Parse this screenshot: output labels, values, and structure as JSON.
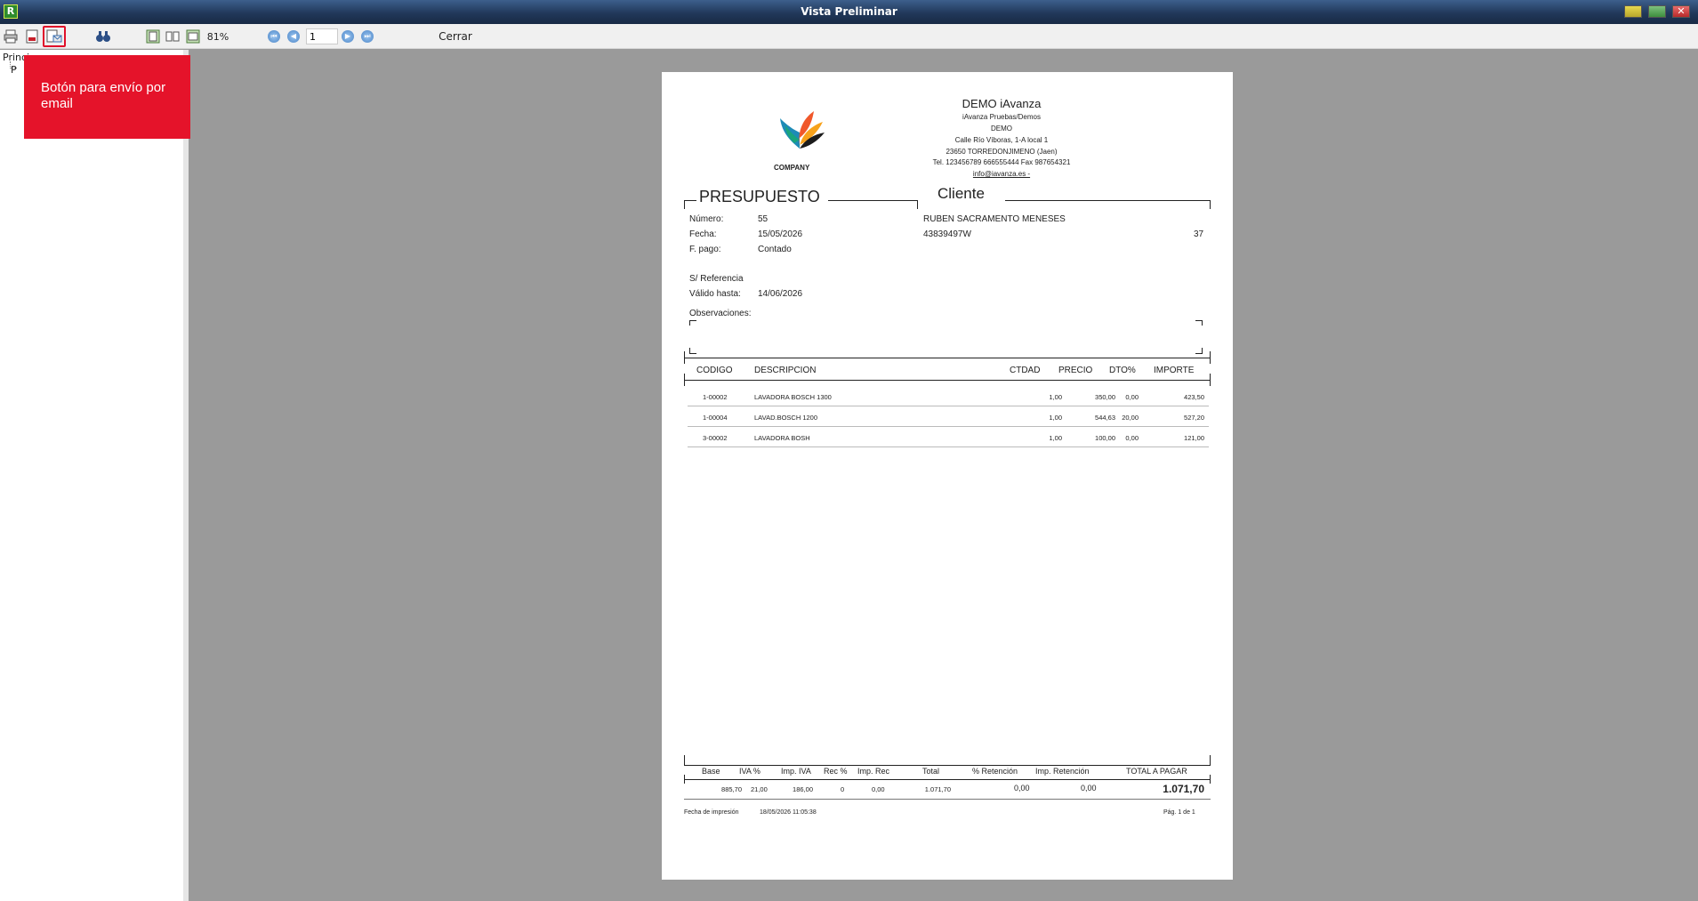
{
  "window": {
    "title": "Vista Preliminar",
    "app_icon": "R"
  },
  "toolbar": {
    "zoom": "81%",
    "page": "1",
    "close_label": "Cerrar"
  },
  "left_panel": {
    "tree_root": "Princi",
    "tree_child": "P"
  },
  "callout": {
    "text": "Botón para envío por email"
  },
  "document": {
    "company": {
      "logo_text": "COMPANY",
      "name": "DEMO iAvanza",
      "lines": [
        "iAvanza Pruebas/Demos",
        "DEMO",
        "Calle Río Víboras, 1-A local 1",
        "23650 TORREDONJIMENO (Jaen)",
        "Tel. 123456789  666555444  Fax 987654321"
      ],
      "email": "info@iavanza.es -"
    },
    "section_title": "PRESUPUESTO",
    "client_title": "Cliente",
    "fields": {
      "numero_label": "Número:",
      "numero": "55",
      "fecha_label": "Fecha:",
      "fecha": "15/05/2026",
      "fpago_label": "F. pago:",
      "fpago": "Contado",
      "sref_label": "S/ Referencia",
      "valido_label": "Válido hasta:",
      "valido": "14/06/2026",
      "obs_label": "Observaciones:"
    },
    "client": {
      "name": "RUBEN SACRAMENTO MENESES",
      "nif": "43839497W",
      "code": "37"
    },
    "table": {
      "headers": [
        "CODIGO",
        "DESCRIPCION",
        "CTDAD",
        "PRECIO",
        "DTO%",
        "IMPORTE"
      ],
      "rows": [
        [
          "1-00002",
          "LAVADORA BOSCH 1300",
          "1,00",
          "350,00",
          "0,00",
          "423,50"
        ],
        [
          "1-00004",
          "LAVAD.BOSCH 1200",
          "1,00",
          "544,63",
          "20,00",
          "527,20"
        ],
        [
          "3-00002",
          "LAVADORA BOSH",
          "1,00",
          "100,00",
          "0,00",
          "121,00"
        ]
      ]
    },
    "totals": {
      "headers": [
        "Base",
        "IVA %",
        "Imp. IVA",
        "Rec %",
        "Imp. Rec",
        "Total",
        "% Retención",
        "Imp. Retención",
        "TOTAL A PAGAR"
      ],
      "values": [
        "885,70",
        "21,00",
        "186,00",
        "0",
        "0,00",
        "1.071,70",
        "0,00",
        "0,00",
        "1.071,70"
      ]
    },
    "footer": {
      "print_label": "Fecha de impresión",
      "print_date": "18/05/2026 11:05:38",
      "page_text": "Pág.   1 de 1"
    }
  }
}
